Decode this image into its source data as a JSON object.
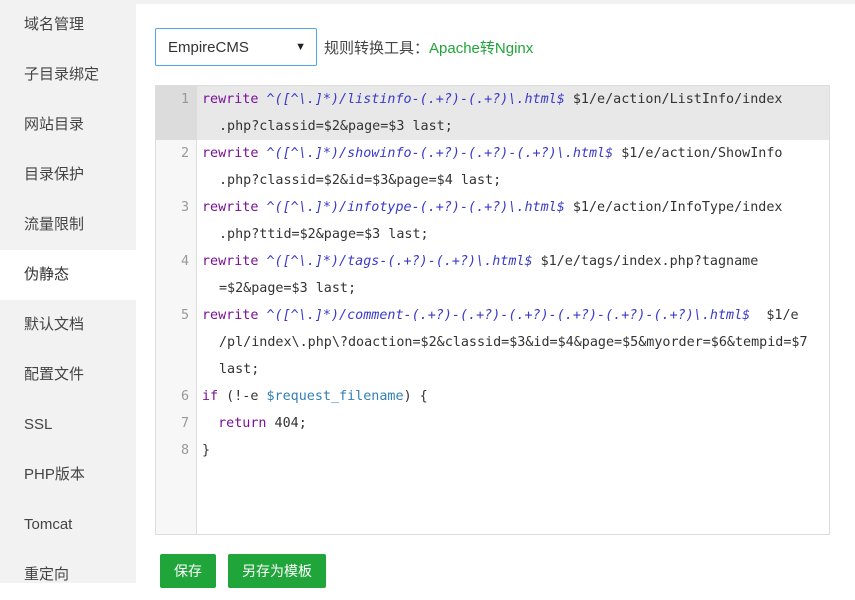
{
  "sidebar": {
    "items": [
      {
        "label": "域名管理"
      },
      {
        "label": "子目录绑定"
      },
      {
        "label": "网站目录"
      },
      {
        "label": "目录保护"
      },
      {
        "label": "流量限制"
      },
      {
        "label": "伪静态"
      },
      {
        "label": "默认文档"
      },
      {
        "label": "配置文件"
      },
      {
        "label": "SSL"
      },
      {
        "label": "PHP版本"
      },
      {
        "label": "Tomcat"
      },
      {
        "label": "重定向"
      }
    ],
    "active_index": 5
  },
  "toolbar": {
    "template_select": "EmpireCMS",
    "tool_label": "规则转换工具：",
    "tool_link": "Apache转Nginx"
  },
  "editor": {
    "lines": [
      {
        "num": "1",
        "kw": "rewrite",
        "rx": " ^([^\\.]*)/listinfo-(.+?)-(.+?)\\.html$",
        "rest": " $1/e/action/ListInfo/index",
        "cont": ".php?classid=$2&page=$3 last;"
      },
      {
        "num": "2",
        "kw": "rewrite",
        "rx": " ^([^\\.]*)/showinfo-(.+?)-(.+?)-(.+?)\\.html$",
        "rest": " $1/e/action/ShowInfo",
        "cont": ".php?classid=$2&id=$3&page=$4 last;"
      },
      {
        "num": "3",
        "kw": "rewrite",
        "rx": " ^([^\\.]*)/infotype-(.+?)-(.+?)\\.html$",
        "rest": " $1/e/action/InfoType/index",
        "cont": ".php?ttid=$2&page=$3 last;"
      },
      {
        "num": "4",
        "kw": "rewrite",
        "rx": " ^([^\\.]*)/tags-(.+?)-(.+?)\\.html$",
        "rest": " $1/e/tags/index.php?tagname",
        "cont": "=$2&page=$3 last;"
      },
      {
        "num": "5",
        "kw": "rewrite",
        "rx": " ^([^\\.]*)/comment-(.+?)-(.+?)-(.+?)-(.+?)-(.+?)-(.+?)\\.html$",
        "rest": "  $1/e",
        "cont": "/pl/index\\.php\\?doaction=$2&classid=$3&id=$4&page=$5&myorder=$6&tempid=$7",
        "cont2": "last;"
      },
      {
        "num": "6",
        "kw": "if",
        "pre": " (!-e ",
        "var": "$request_filename",
        "post": ") {"
      },
      {
        "num": "7",
        "kw": "  return",
        "post": " 404;"
      },
      {
        "num": "8",
        "post": "}"
      }
    ]
  },
  "buttons": {
    "save": "保存",
    "save_template": "另存为模板"
  }
}
